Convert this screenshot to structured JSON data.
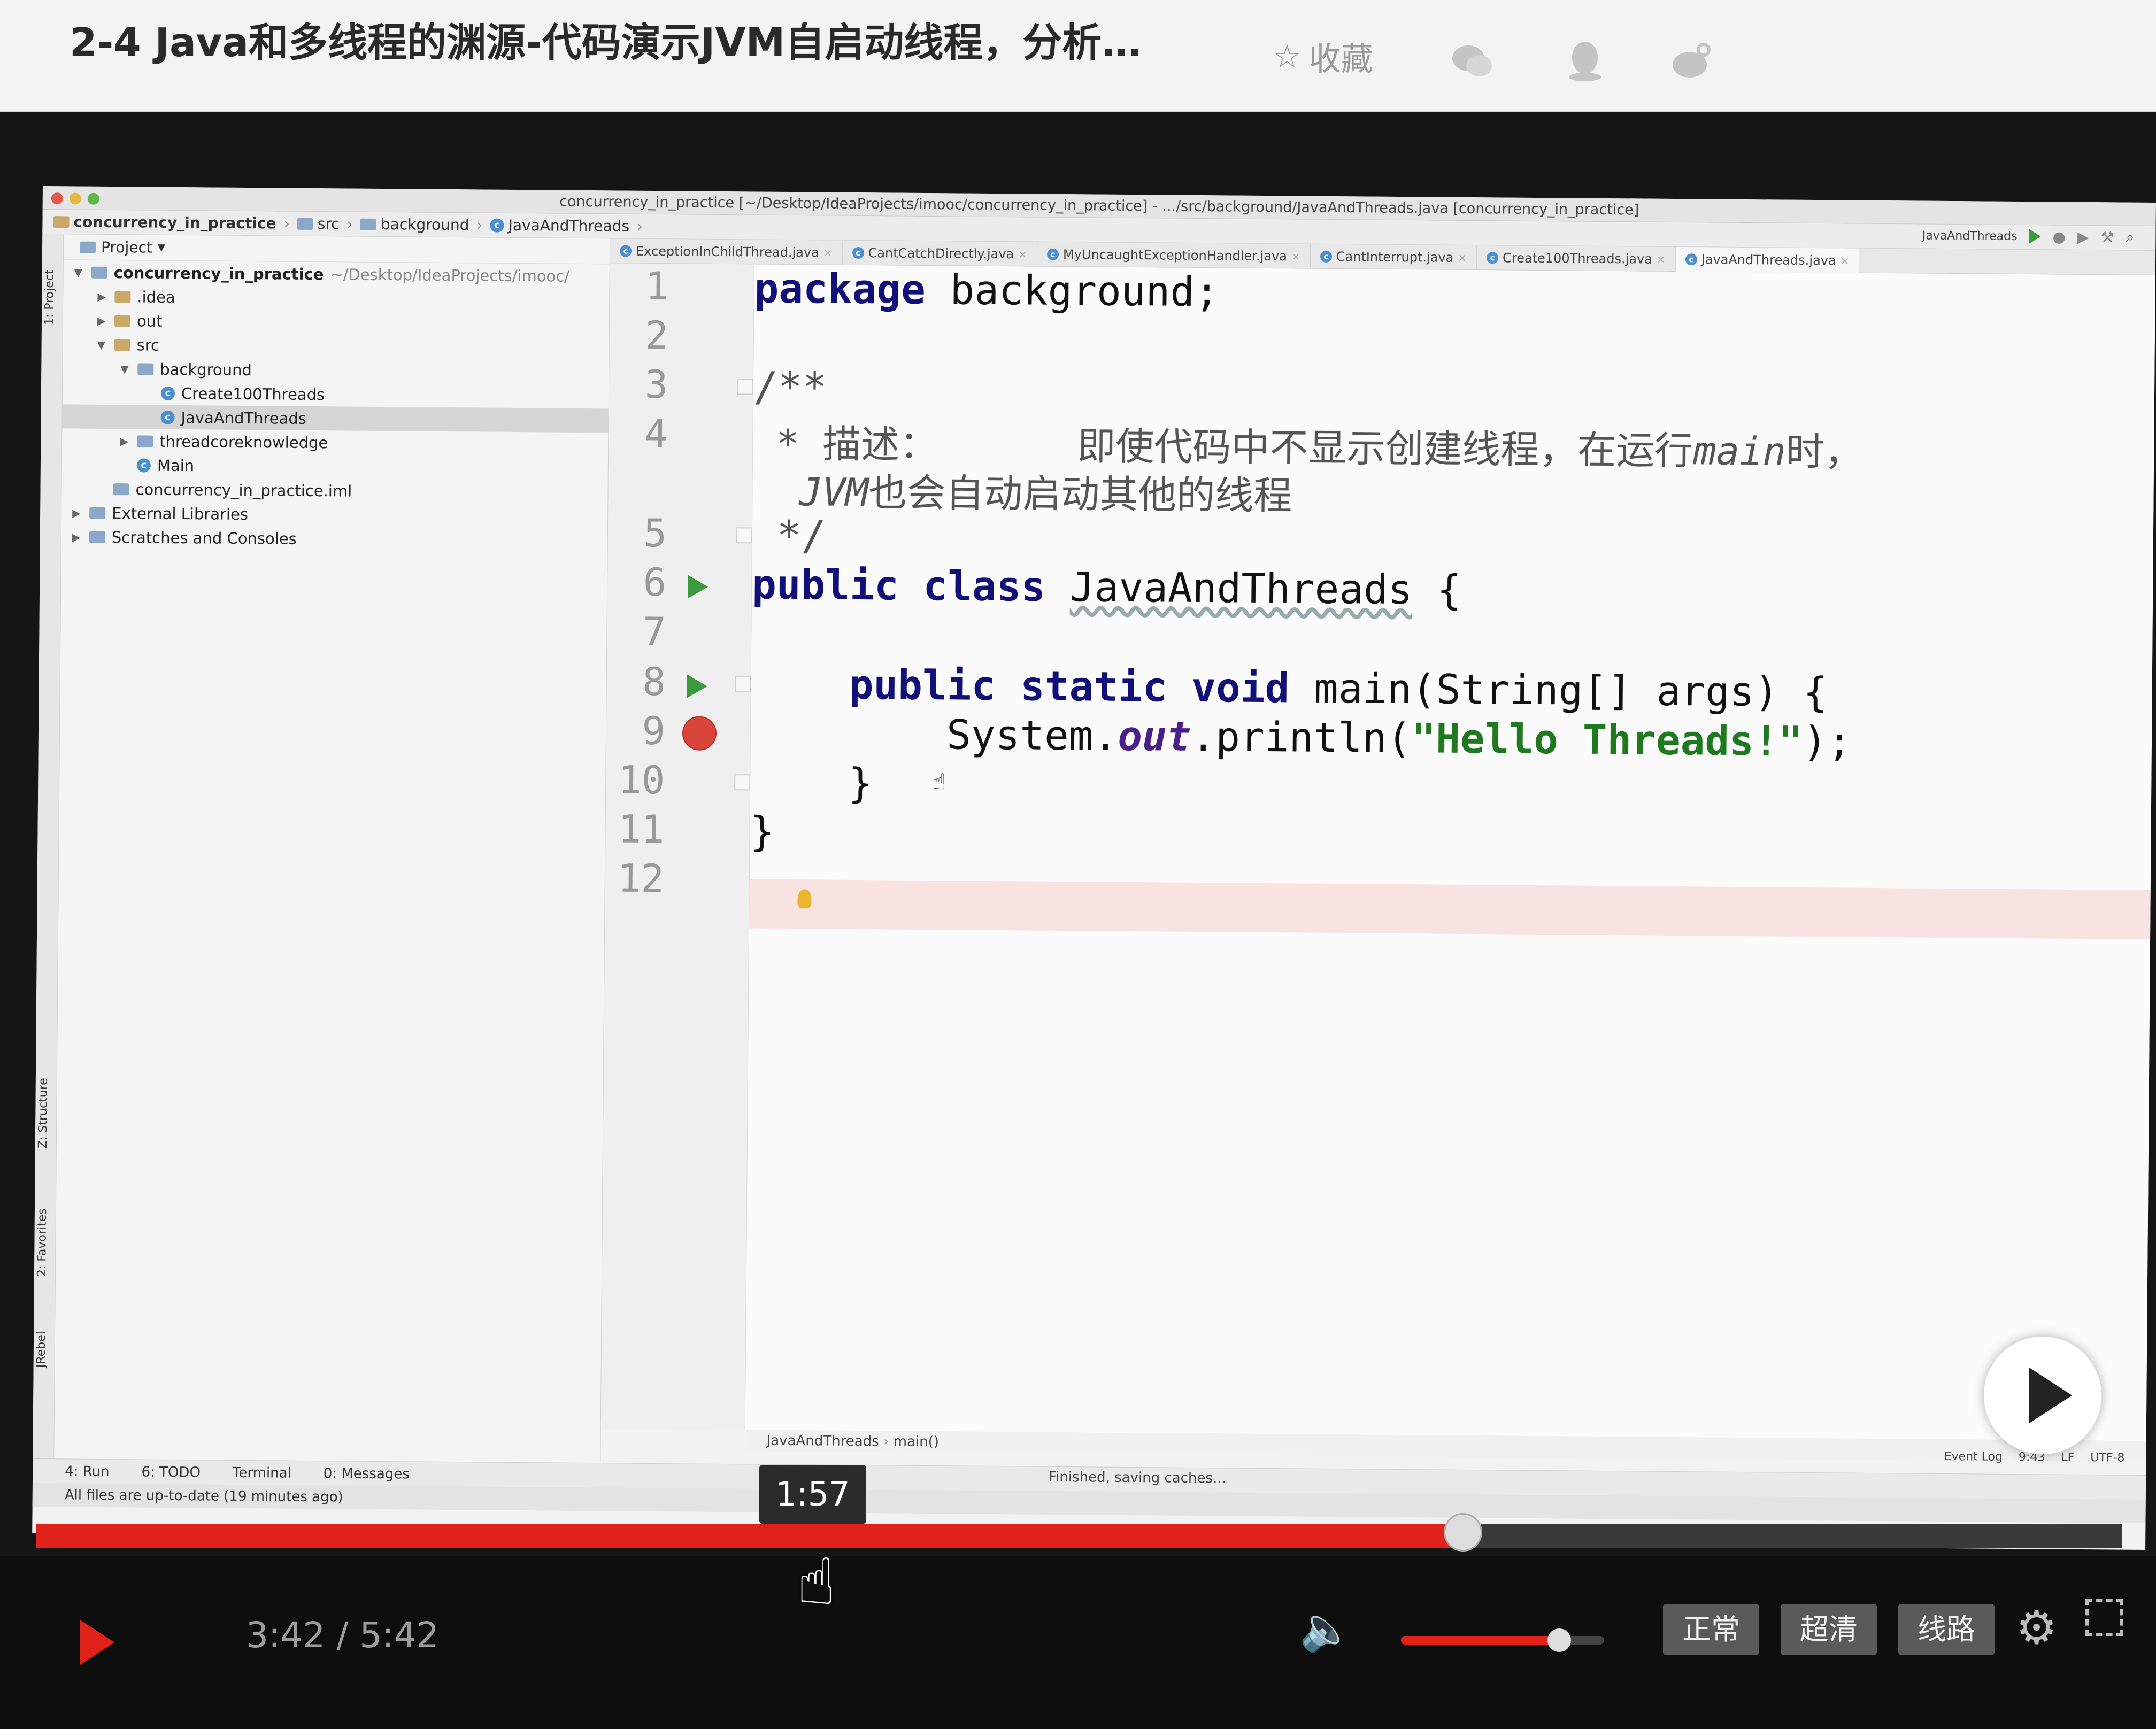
{
  "page": {
    "lesson_title": "2-4 Java和多线程的渊源-代码演示JVM自启动线程，分析…",
    "collect_label": "收藏",
    "share_icons": [
      "wechat-icon",
      "qq-icon",
      "weibo-icon"
    ]
  },
  "ide": {
    "window_title": "concurrency_in_practice [~/Desktop/IdeaProjects/imooc/concurrency_in_practice] - .../src/background/JavaAndThreads.java [concurrency_in_practice]",
    "breadcrumb": [
      "concurrency_in_practice",
      "src",
      "background",
      "JavaAndThreads"
    ],
    "run_config": "JavaAndThreads",
    "project_panel_title": "Project",
    "project_tree": [
      {
        "label": "concurrency_in_practice",
        "suffix": "~/Desktop/IdeaProjects/imooc/",
        "icon": "module-icon",
        "depth": 0,
        "arrow": "▼"
      },
      {
        "label": ".idea",
        "icon": "folder-icon",
        "depth": 1,
        "arrow": "▶"
      },
      {
        "label": "out",
        "icon": "folder-icon",
        "depth": 1,
        "arrow": "▶"
      },
      {
        "label": "src",
        "icon": "folder-icon",
        "depth": 1,
        "arrow": "▼"
      },
      {
        "label": "background",
        "icon": "package-icon",
        "depth": 2,
        "arrow": "▼"
      },
      {
        "label": "Create100Threads",
        "icon": "class-icon",
        "depth": 3,
        "arrow": ""
      },
      {
        "label": "JavaAndThreads",
        "icon": "class-icon",
        "depth": 3,
        "arrow": "",
        "selected": true
      },
      {
        "label": "threadcoreknowledge",
        "icon": "package-icon",
        "depth": 2,
        "arrow": "▶"
      },
      {
        "label": "Main",
        "icon": "class-icon",
        "depth": 2,
        "arrow": ""
      },
      {
        "label": "concurrency_in_practice.iml",
        "icon": "file-icon",
        "depth": 1,
        "arrow": ""
      },
      {
        "label": "External Libraries",
        "icon": "library-icon",
        "depth": 0,
        "arrow": "▶"
      },
      {
        "label": "Scratches and Consoles",
        "icon": "scratch-icon",
        "depth": 0,
        "arrow": "▶"
      }
    ],
    "tabs": [
      {
        "label": "ExceptionInChildThread.java",
        "active": false
      },
      {
        "label": "CantCatchDirectly.java",
        "active": false
      },
      {
        "label": "MyUncaughtExceptionHandler.java",
        "active": false
      },
      {
        "label": "CantInterrupt.java",
        "active": false
      },
      {
        "label": "Create100Threads.java",
        "active": false
      },
      {
        "label": "JavaAndThreads.java",
        "active": true
      }
    ],
    "line_numbers": [
      "1",
      "2",
      "3",
      "4",
      "5",
      "6",
      "7",
      "8",
      "9",
      "10",
      "11",
      "12"
    ],
    "code": {
      "l1_kw": "package",
      "l1_rest": " background;",
      "l3": "/**",
      "l4a": " * 描述：      即使代码中不显示创建线程，在运行",
      "l4b": "main",
      "l4c": "时，",
      "l4d": "JVM",
      "l4e": "也会自动启动其他的线程",
      "l5": " */",
      "l6_kw": "public class",
      "l6_name": "JavaAndThreads",
      "l6_rest": " {",
      "l8_kw": "    public static void",
      "l8_rest": " main(String[] args) {",
      "l9a": "        System.",
      "l9b": "out",
      "l9c": ".println(",
      "l9d": "\"Hello Threads!\"",
      "l9e": ");",
      "l10": "    }",
      "l11": "}"
    },
    "editor_breadcrumb": [
      "JavaAndThreads",
      "main()"
    ],
    "bottom_tools": [
      "4: Run",
      "6: TODO",
      "Terminal",
      "0: Messages"
    ],
    "status_message": "Finished, saving caches...",
    "status_bar": "All files are up-to-date (19 minutes ago)",
    "right_status": [
      "Event Log",
      "9:43",
      "LF",
      "UTF-8"
    ],
    "left_strip": [
      "1: Project",
      "Z: Structure",
      "2: Favorites",
      "JRebel"
    ]
  },
  "player": {
    "hover_time": "1:57",
    "time_display": "3:42 / 5:42",
    "progress_fraction": 0.684,
    "volume_fraction": 0.78,
    "buttons": [
      "正常",
      "超清",
      "线路"
    ],
    "accent_color": "#e0221a"
  }
}
